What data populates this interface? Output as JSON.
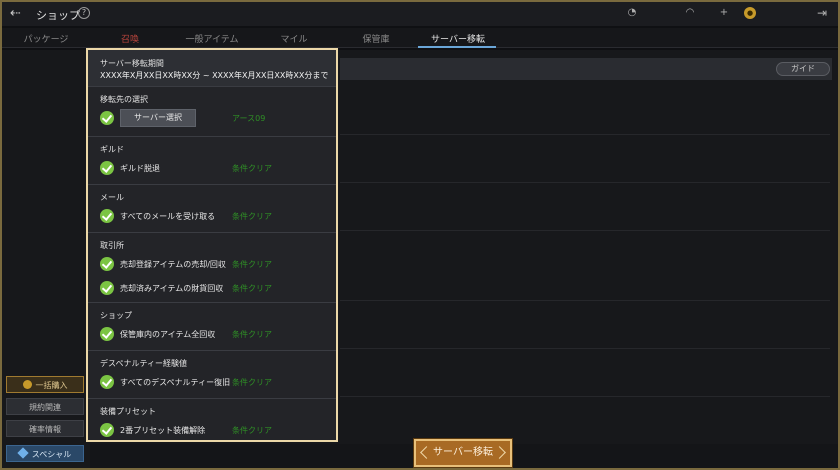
{
  "header": {
    "back_icon": "back-arrow-icon",
    "title": "ショップ",
    "help_icon": "help-icon",
    "right_icons": [
      "clock-icon",
      "wifi-icon",
      "plus-icon",
      "coin-icon",
      "exit-icon"
    ]
  },
  "tabs": [
    {
      "label": "パッケージ",
      "active": false
    },
    {
      "label": "召喚",
      "active": false
    },
    {
      "label": "一般アイテム",
      "active": false
    },
    {
      "label": "マイル",
      "active": false
    },
    {
      "label": "保管庫",
      "active": false
    },
    {
      "label": "サーバー移転",
      "active": true
    }
  ],
  "guide_label": "ガイド",
  "left_buttons": [
    {
      "label": "一括購入"
    },
    {
      "label": "規約関連"
    },
    {
      "label": "確率情報"
    },
    {
      "label": "スペシャル"
    }
  ],
  "panel": {
    "title": "サーバー移転期間",
    "period": "XXXX年X月XX日XX時XX分 ~ XXXX年X月XX日XX時XX分まで",
    "sections": [
      {
        "title": "移転先の選択",
        "items": [
          {
            "label": "サーバー選択",
            "status": "アース09",
            "is_button": true
          }
        ]
      },
      {
        "title": "ギルド",
        "items": [
          {
            "label": "ギルド脱退",
            "status": "条件クリア"
          }
        ]
      },
      {
        "title": "メール",
        "items": [
          {
            "label": "すべてのメールを受け取る",
            "status": "条件クリア"
          }
        ]
      },
      {
        "title": "取引所",
        "items": [
          {
            "label": "売却登録アイテムの売却/回収",
            "status": "条件クリア"
          },
          {
            "label": "売却済みアイテムの財貨回収",
            "status": "条件クリア"
          }
        ]
      },
      {
        "title": "ショップ",
        "items": [
          {
            "label": "保管庫内のアイテム全回収",
            "status": "条件クリア"
          }
        ]
      },
      {
        "title": "デスペナルティー経験値",
        "items": [
          {
            "label": "すべてのデスペナルティー復旧",
            "status": "条件クリア"
          }
        ]
      },
      {
        "title": "装備プリセット",
        "items": [
          {
            "label": "2番プリセット装備解除",
            "status": "条件クリア"
          }
        ]
      }
    ]
  },
  "transfer_button": "サーバー移転",
  "colors": {
    "accent_gold": "#ecd8a8",
    "check_green": "#7bc443",
    "status_green": "#2f8f26",
    "tab_underline": "#6aa6d8"
  }
}
